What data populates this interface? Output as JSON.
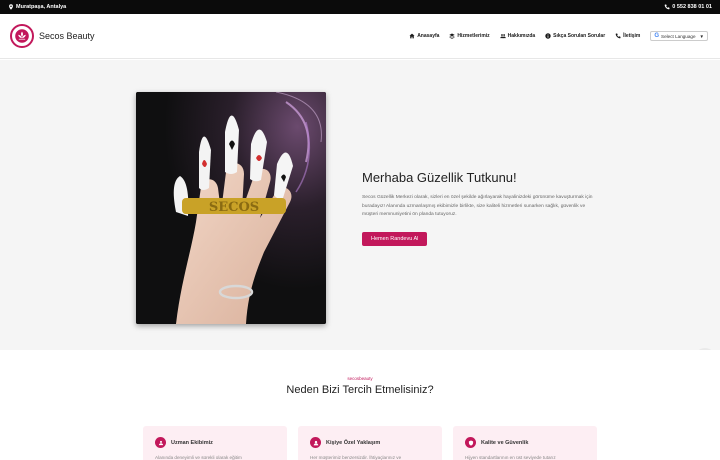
{
  "topbar": {
    "location": "Muratpaşa, Antalya",
    "phone": "0 552 838 01 01"
  },
  "brand": {
    "name": "Secos Beauty",
    "accent": "#c2185b"
  },
  "nav": {
    "items": [
      {
        "label": "Anasayfa",
        "icon": "home-icon"
      },
      {
        "label": "Hizmetlerimiz",
        "icon": "layers-icon"
      },
      {
        "label": "Hakkımızda",
        "icon": "users-icon"
      },
      {
        "label": "Sıkça Sorulan Sorular",
        "icon": "info-icon"
      },
      {
        "label": "İletişim",
        "icon": "phone-icon"
      }
    ],
    "language": {
      "label": "Select Language",
      "icon": "google-icon"
    }
  },
  "hero": {
    "title": "Merhaba Güzellik Tutkunu!",
    "description": "Secos Güzellik Merkezi olarak, sizleri en özel şekilde ağırlayarak hayalinizdeki görünüme kavuşturmak için buradayız! Alanında uzmanlaşmış ekibimizle birlikte, size kaliteli hizmetleri sunarken sağlık, güvenlik ve müşteri memnuniyetini ön planda tutuyoruz.",
    "cta": "Hemen Randevu Al",
    "image_ring_text": "SECOS"
  },
  "why": {
    "eyebrow": "secosbeauty",
    "title": "Neden Bizi Tercih Etmelisiniz?",
    "cards": [
      {
        "title": "Uzman Ekibimiz",
        "icon": "team-icon",
        "text": "Alanında deneyimli ve sürekli olarak eğitim"
      },
      {
        "title": "Kişiye Özel Yaklaşım",
        "icon": "user-icon",
        "text": "Her müşterimiz benzersizdir. İhtiyaçlarınız ve"
      },
      {
        "title": "Kalite ve Güvenlik",
        "icon": "shield-icon",
        "text": "Hijyen standartlarının en üst seviyede tutarız"
      }
    ]
  }
}
